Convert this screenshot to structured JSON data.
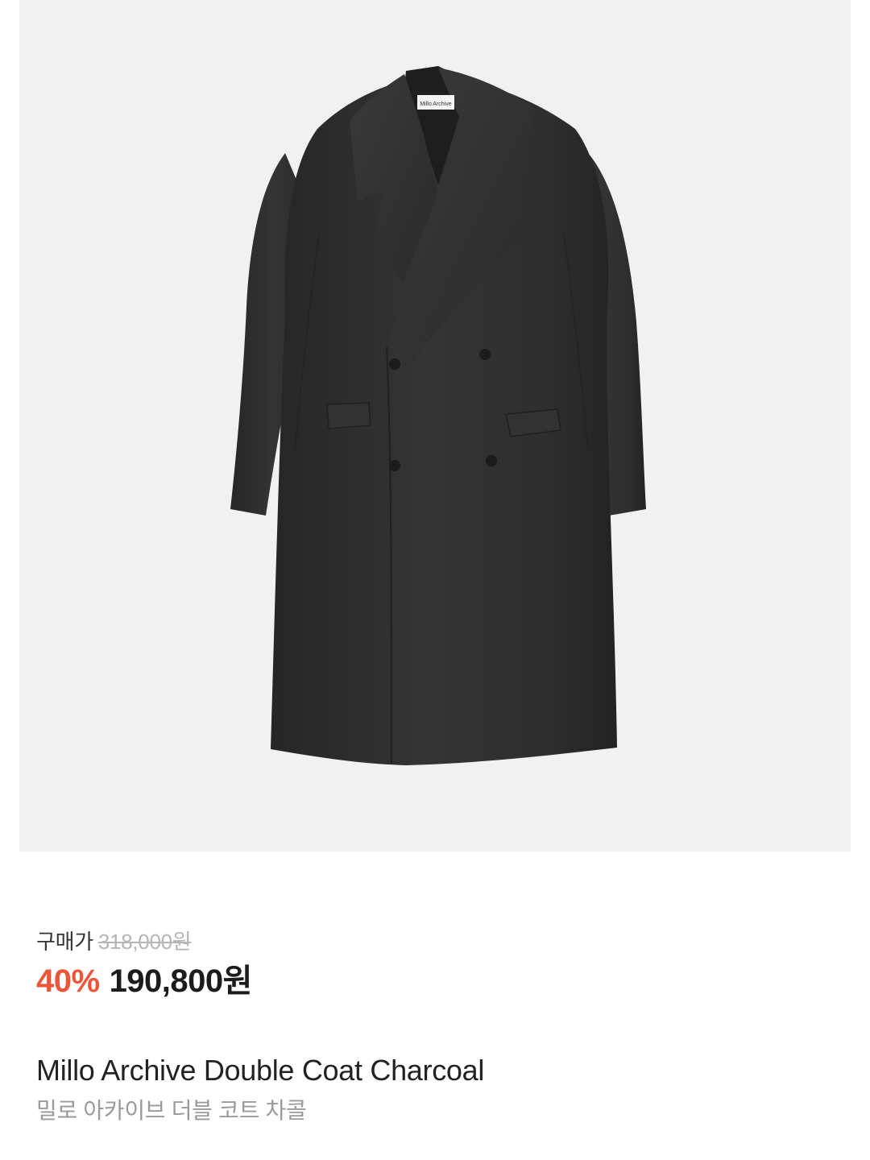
{
  "product": {
    "image": {
      "description_icon": "coat-image",
      "background": "#f1f1f1",
      "garment_color": "#2f2f30",
      "label_text": "Millo Archive"
    },
    "price": {
      "label": "구매가",
      "original": "318,000원",
      "discount": "40%",
      "sale": "190,800원",
      "discount_color": "#ec5539"
    },
    "name_en": "Millo Archive Double Coat Charcoal",
    "name_ko": "밀로 아카이브 더블 코트 차콜"
  }
}
